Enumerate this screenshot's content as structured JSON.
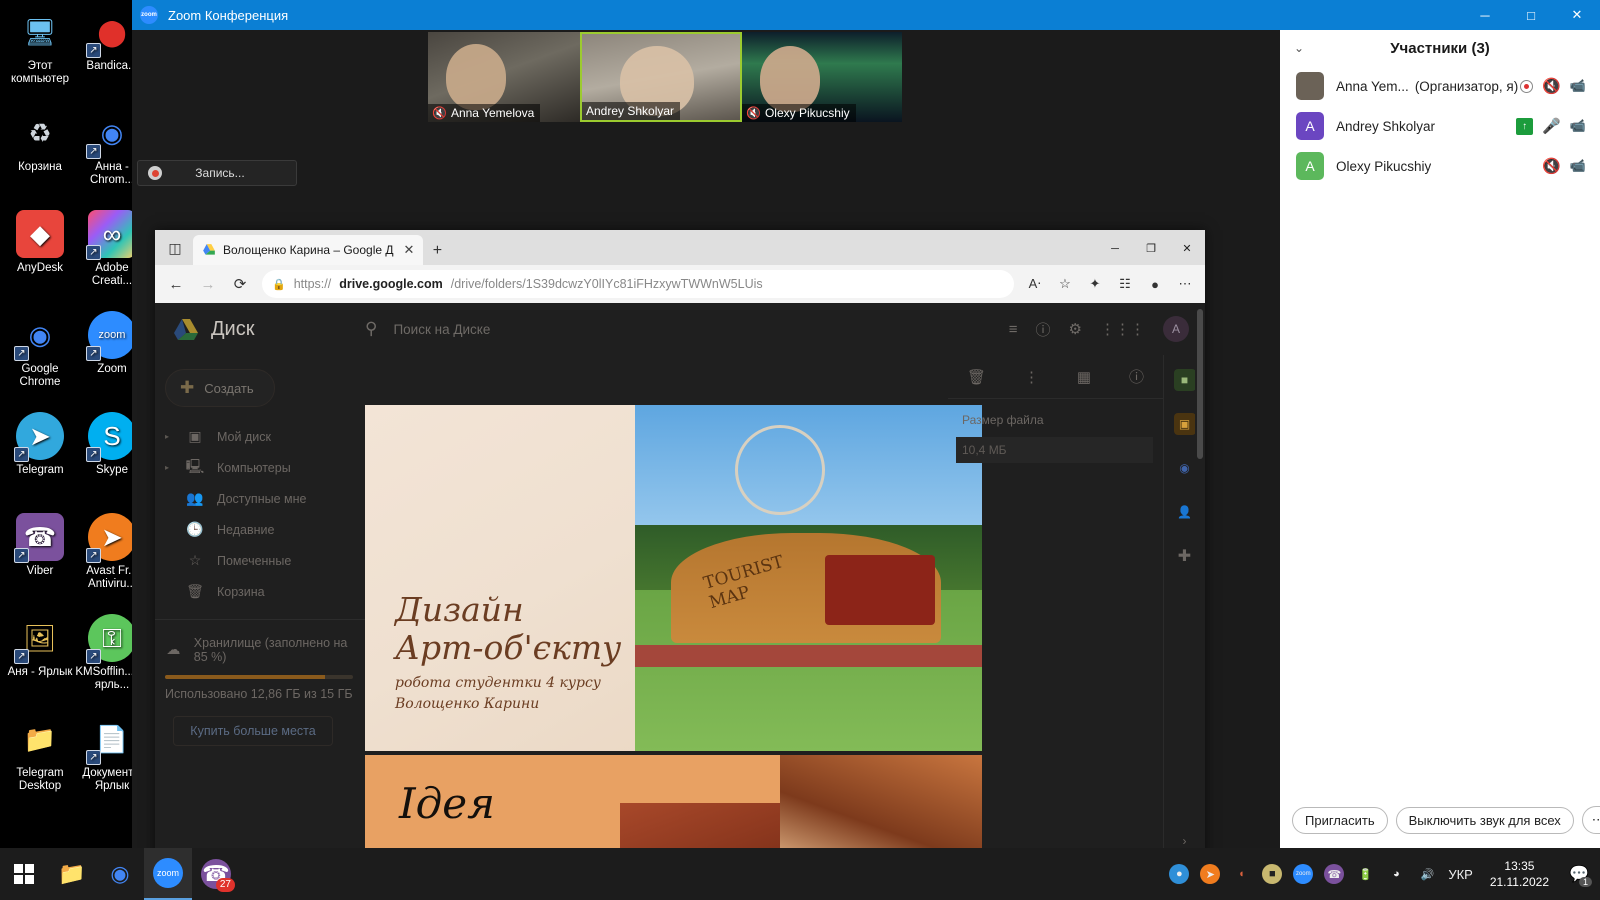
{
  "desktop": {
    "icons": [
      {
        "label": "Этот компьютер",
        "icon": "computer-icon",
        "shortcut": false
      },
      {
        "label": "Bandica...",
        "icon": "bandicam-icon",
        "shortcut": true
      },
      {
        "label": "Корзина",
        "icon": "recycle-bin-icon",
        "shortcut": false
      },
      {
        "label": "Анна - Chrom...",
        "icon": "chrome-profile-icon",
        "shortcut": true
      },
      {
        "label": "AnyDesk",
        "icon": "anydesk-icon",
        "shortcut": false
      },
      {
        "label": "Adobe Creati...",
        "icon": "adobe-cc-icon",
        "shortcut": true
      },
      {
        "label": "Google Chrome",
        "icon": "chrome-icon",
        "shortcut": true
      },
      {
        "label": "Zoom",
        "icon": "zoom-icon",
        "shortcut": true
      },
      {
        "label": "Telegram",
        "icon": "telegram-icon",
        "shortcut": true
      },
      {
        "label": "Skype",
        "icon": "skype-icon",
        "shortcut": true
      },
      {
        "label": "Viber",
        "icon": "viber-icon",
        "shortcut": true
      },
      {
        "label": "Avast Fr... Antiviru...",
        "icon": "avast-icon",
        "shortcut": true
      },
      {
        "label": "Аня - Ярлык",
        "icon": "folder-picture-icon",
        "shortcut": true
      },
      {
        "label": "KMSofflin... — ярль...",
        "icon": "kms-key-icon",
        "shortcut": true
      },
      {
        "label": "Telegram Desktop",
        "icon": "folder-icon",
        "shortcut": false
      },
      {
        "label": "Документ... Ярлык",
        "icon": "folder-document-icon",
        "shortcut": true
      }
    ]
  },
  "zoom_window": {
    "title": "Zoom Конференция",
    "logo_text": "zoom",
    "window_buttons": {
      "minimize": "─",
      "maximize": "□",
      "close": "✕"
    },
    "recording_label": "Запись...",
    "video_tiles": [
      {
        "name": "Anna Yemelova",
        "muted": true,
        "active": false
      },
      {
        "name": "Andrey Shkolyar",
        "muted": false,
        "active": true
      },
      {
        "name": "Olexy Pikucshiy",
        "muted": true,
        "active": false
      }
    ],
    "participants": {
      "header": "Участники (3)",
      "chevron": "⌄",
      "rows": [
        {
          "name": "Anna Yem...",
          "role": "(Организатор, я)",
          "avatar_letter": "",
          "avatar_color": "#6b6257",
          "avatar_type": "photo",
          "recording": true,
          "muted": true,
          "video_on": true,
          "green_badge": false
        },
        {
          "name": "Andrey Shkolyar",
          "role": "",
          "avatar_letter": "A",
          "avatar_color": "#6b46c1",
          "avatar_type": "letter",
          "recording": false,
          "muted": false,
          "video_on": true,
          "green_badge": true
        },
        {
          "name": "Olexy Pikucshiy",
          "role": "",
          "avatar_letter": "A",
          "avatar_color": "#5cb85c",
          "avatar_type": "letter",
          "recording": false,
          "muted": true,
          "video_on": true,
          "green_badge": false
        }
      ],
      "footer": {
        "invite": "Пригласить",
        "mute_all": "Выключить звук для всех",
        "more": "⋯"
      }
    }
  },
  "browser": {
    "tab": {
      "title": "Волощенко Карина  – Google Д",
      "favicon": "google-drive-icon",
      "close": "✕"
    },
    "new_tab": "+",
    "tab_actions_icon": "tab-actions-icon",
    "nav": {
      "back": "←",
      "forward": "→",
      "reload": "⟳"
    },
    "url": {
      "prefix": "https://",
      "domain": "drive.google.com",
      "path": "/drive/folders/1S39dcwzY0lIYc81iFHzxywTWWnW5LUis",
      "lock_icon": "lock-icon"
    },
    "toolbar_icons": [
      "read-aloud-icon",
      "favorite-icon",
      "collections-icon",
      "split-screen-icon",
      "profile-icon",
      "settings-more-icon"
    ],
    "window_buttons": {
      "minimize": "─",
      "maximize": "❐",
      "close": "✕"
    }
  },
  "drive": {
    "logo_label": "Диск",
    "search_placeholder": "Поиск на Диске",
    "search_icon": "search-icon",
    "filter_icon": "search-options-icon",
    "top_right_icons": [
      "help-icon",
      "settings-gear-icon",
      "apps-grid-icon"
    ],
    "account_letter": "A",
    "create_button": "Создать",
    "nav_items": [
      {
        "label": "Мой диск",
        "icon": "my-drive-icon",
        "expandable": true
      },
      {
        "label": "Компьютеры",
        "icon": "computers-icon",
        "expandable": true
      },
      {
        "label": "Доступные мне",
        "icon": "shared-with-me-icon",
        "expandable": false
      },
      {
        "label": "Недавние",
        "icon": "recent-clock-icon",
        "expandable": false
      },
      {
        "label": "Помеченные",
        "icon": "starred-icon",
        "expandable": false
      },
      {
        "label": "Корзина",
        "icon": "trash-icon",
        "expandable": false
      }
    ],
    "storage": {
      "label": "Хранилище (заполнено на 85 %)",
      "icon": "cloud-icon",
      "used_text": "Использовано 12,86 ГБ из 15 ГБ",
      "percent": 85,
      "buy_button": "Купить больше места"
    },
    "preview": {
      "icons": [
        "delete-icon",
        "more-vert-icon",
        "grid-view-icon",
        "info-icon"
      ],
      "file_size_label": "Размер файла",
      "file_size_value": "10,4 МБ"
    },
    "rail_icons": [
      "keep-icon",
      "tasks-icon",
      "contacts-icon",
      "add-ons-plus-icon",
      "expand-arrow-icon"
    ],
    "slides": [
      {
        "title_line1": "Дизайн",
        "title_line2": "Арт-об'єкту",
        "sub_line1": "робота студентки 4 курсу",
        "sub_line2": "Волощенко Карини",
        "photo_caption": "TOURIST MAP"
      },
      {
        "title": "Ідея"
      }
    ]
  },
  "taskbar": {
    "start_icon": "windows-start-icon",
    "apps": [
      {
        "name": "file-explorer",
        "icon": "folder-icon",
        "active": false,
        "badge": ""
      },
      {
        "name": "google-chrome",
        "icon": "chrome-icon",
        "active": false,
        "badge": ""
      },
      {
        "name": "zoom",
        "icon": "zoom-icon",
        "active": true,
        "badge": ""
      },
      {
        "name": "viber",
        "icon": "viber-icon",
        "active": false,
        "badge": "27"
      }
    ],
    "tray_icons": [
      "signal-icon",
      "avast-icon",
      "unknown-icon",
      "bandicam-icon",
      "zoom-tray-icon",
      "viber-tray-icon",
      "battery-icon",
      "wifi-icon",
      "volume-icon"
    ],
    "language": "УКР",
    "time": "13:35",
    "date": "21.11.2022",
    "notification_icon": "notifications-icon",
    "notification_count": "1"
  },
  "colors": {
    "zoom_blue": "#0b7fd4",
    "accent_green": "#1c9c3c",
    "mute_red": "#e04545",
    "taskbar": "#1c1c1c",
    "drive_dark": "#1f1f1f",
    "slide_orange": "#e8a163"
  }
}
